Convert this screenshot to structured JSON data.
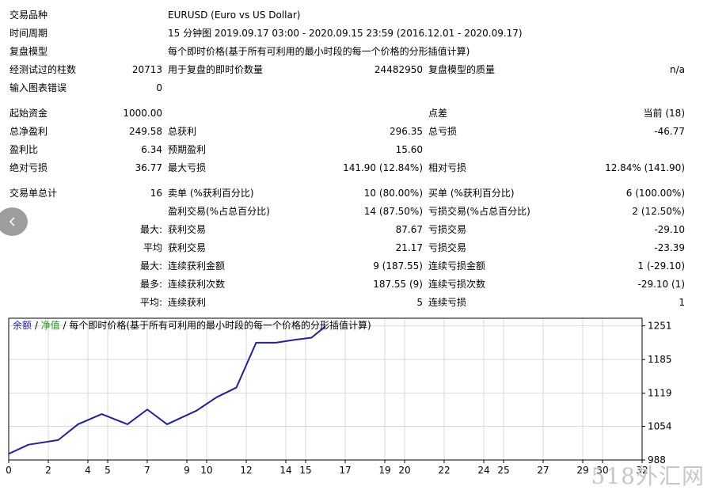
{
  "report": {
    "rows": [
      {
        "cells": [
          {
            "text": "交易品种",
            "x": 12,
            "a": "l"
          },
          {
            "text": "EURUSD (Euro vs US Dollar)",
            "x": 212,
            "a": "l"
          }
        ],
        "y": 11
      },
      {
        "cells": [
          {
            "text": "时间周期",
            "x": 12,
            "a": "l"
          },
          {
            "text": "15 分钟图 2019.09.17 03:00 - 2020.09.15 23:59 (2016.12.01 - 2020.09.17)",
            "x": 212,
            "a": "l"
          }
        ],
        "y": 34
      },
      {
        "cells": [
          {
            "text": "复盘模型",
            "x": 12,
            "a": "l"
          },
          {
            "text": "每个即时价格(基于所有可利用的最小时段的每一个价格的分形插值计算)",
            "x": 212,
            "a": "l"
          }
        ],
        "y": 57
      },
      {
        "cells": [
          {
            "text": "经测试过的柱数",
            "x": 12,
            "a": "l"
          },
          {
            "text": "20713",
            "x": 205,
            "a": "r"
          },
          {
            "text": "用于复盘的即时价数量",
            "x": 212,
            "a": "l"
          },
          {
            "text": "24482950",
            "x": 534,
            "a": "r"
          },
          {
            "text": "复盘模型的质量",
            "x": 541,
            "a": "l"
          },
          {
            "text": "n/a",
            "x": 865,
            "a": "r"
          }
        ],
        "y": 80
      },
      {
        "cells": [
          {
            "text": "输入图表错误",
            "x": 12,
            "a": "l"
          },
          {
            "text": "0",
            "x": 205,
            "a": "r"
          }
        ],
        "y": 103
      },
      {
        "cells": [
          {
            "text": "起始资金",
            "x": 12,
            "a": "l"
          },
          {
            "text": "1000.00",
            "x": 205,
            "a": "r"
          },
          {
            "text": "点差",
            "x": 541,
            "a": "l"
          },
          {
            "text": "当前 (18)",
            "x": 865,
            "a": "r"
          }
        ],
        "y": 135
      },
      {
        "cells": [
          {
            "text": "总净盈利",
            "x": 12,
            "a": "l"
          },
          {
            "text": "249.58",
            "x": 205,
            "a": "r"
          },
          {
            "text": "总获利",
            "x": 212,
            "a": "l"
          },
          {
            "text": "296.35",
            "x": 534,
            "a": "r"
          },
          {
            "text": "总亏损",
            "x": 541,
            "a": "l"
          },
          {
            "text": "-46.77",
            "x": 865,
            "a": "r"
          }
        ],
        "y": 158
      },
      {
        "cells": [
          {
            "text": "盈利比",
            "x": 12,
            "a": "l"
          },
          {
            "text": "6.34",
            "x": 205,
            "a": "r"
          },
          {
            "text": "预期盈利",
            "x": 212,
            "a": "l"
          },
          {
            "text": "15.60",
            "x": 534,
            "a": "r"
          }
        ],
        "y": 181
      },
      {
        "cells": [
          {
            "text": "绝对亏损",
            "x": 12,
            "a": "l"
          },
          {
            "text": "36.77",
            "x": 205,
            "a": "r"
          },
          {
            "text": "最大亏损",
            "x": 212,
            "a": "l"
          },
          {
            "text": "141.90 (12.84%)",
            "x": 534,
            "a": "r"
          },
          {
            "text": "相对亏损",
            "x": 541,
            "a": "l"
          },
          {
            "text": "12.84% (141.90)",
            "x": 865,
            "a": "r"
          }
        ],
        "y": 204
      },
      {
        "cells": [
          {
            "text": "交易单总计",
            "x": 12,
            "a": "l"
          },
          {
            "text": "16",
            "x": 205,
            "a": "r"
          },
          {
            "text": "卖单 (%获利百分比)",
            "x": 212,
            "a": "l"
          },
          {
            "text": "10 (80.00%)",
            "x": 534,
            "a": "r"
          },
          {
            "text": "买单 (%获利百分比)",
            "x": 541,
            "a": "l"
          },
          {
            "text": "6 (100.00%)",
            "x": 865,
            "a": "r"
          }
        ],
        "y": 236
      },
      {
        "cells": [
          {
            "text": "盈利交易(%占总百分比)",
            "x": 212,
            "a": "l"
          },
          {
            "text": "14 (87.50%)",
            "x": 534,
            "a": "r"
          },
          {
            "text": "亏损交易(%占总百分比)",
            "x": 541,
            "a": "l"
          },
          {
            "text": "2 (12.50%)",
            "x": 865,
            "a": "r"
          }
        ],
        "y": 259
      },
      {
        "cells": [
          {
            "text": "最大:",
            "x": 205,
            "a": "r"
          },
          {
            "text": "获利交易",
            "x": 212,
            "a": "l"
          },
          {
            "text": "87.67",
            "x": 534,
            "a": "r"
          },
          {
            "text": "亏损交易",
            "x": 541,
            "a": "l"
          },
          {
            "text": "-29.10",
            "x": 865,
            "a": "r"
          }
        ],
        "y": 282
      },
      {
        "cells": [
          {
            "text": "平均",
            "x": 205,
            "a": "r"
          },
          {
            "text": "获利交易",
            "x": 212,
            "a": "l"
          },
          {
            "text": "21.17",
            "x": 534,
            "a": "r"
          },
          {
            "text": "亏损交易",
            "x": 541,
            "a": "l"
          },
          {
            "text": "-23.39",
            "x": 865,
            "a": "r"
          }
        ],
        "y": 305
      },
      {
        "cells": [
          {
            "text": "最大:",
            "x": 205,
            "a": "r"
          },
          {
            "text": "连续获利金额",
            "x": 212,
            "a": "l"
          },
          {
            "text": "9 (187.55)",
            "x": 534,
            "a": "r"
          },
          {
            "text": "连续亏损金额",
            "x": 541,
            "a": "l"
          },
          {
            "text": "1 (-29.10)",
            "x": 865,
            "a": "r"
          }
        ],
        "y": 328
      },
      {
        "cells": [
          {
            "text": "最多:",
            "x": 205,
            "a": "r"
          },
          {
            "text": "连续获利次数",
            "x": 212,
            "a": "l"
          },
          {
            "text": "187.55 (9)",
            "x": 534,
            "a": "r"
          },
          {
            "text": "连续亏损次数",
            "x": 541,
            "a": "l"
          },
          {
            "text": "-29.10 (1)",
            "x": 865,
            "a": "r"
          }
        ],
        "y": 351
      },
      {
        "cells": [
          {
            "text": "平均:",
            "x": 205,
            "a": "r"
          },
          {
            "text": "连续获利",
            "x": 212,
            "a": "l"
          },
          {
            "text": "5",
            "x": 534,
            "a": "r"
          },
          {
            "text": "连续亏损",
            "x": 541,
            "a": "l"
          },
          {
            "text": "1",
            "x": 865,
            "a": "r"
          }
        ],
        "y": 374
      }
    ]
  },
  "nav": {
    "back_icon": "chevron-left-icon"
  },
  "chart_data": {
    "type": "line",
    "legend": {
      "balance": "余额",
      "sep1": " / ",
      "equity": "净值",
      "sep2": " / ",
      "model": "每个即时价格(基于所有可利用的最小时段的每一个价格的分形插值计算)"
    },
    "colors": {
      "balance": "#1f1fa8",
      "equity": "#1a9a1a",
      "axis": "#000000",
      "grid": "#d9d9d9"
    },
    "x_ticks": [
      0,
      2,
      4,
      5,
      7,
      9,
      10,
      12,
      14,
      15,
      17,
      19,
      20,
      22,
      24,
      25,
      27,
      29,
      30,
      32
    ],
    "x_tick_labels": [
      "0",
      "2",
      "4",
      "5",
      "7",
      "9",
      "10",
      "12",
      "14",
      "15",
      "17",
      "19",
      "20",
      "22",
      "24",
      "25",
      "27",
      "29",
      "30",
      "32"
    ],
    "xlim": [
      0,
      32
    ],
    "y_ticks": [
      988,
      1054,
      1119,
      1185,
      1251
    ],
    "y_tick_labels": [
      "988",
      "1054",
      "1119",
      "1185",
      "1251"
    ],
    "ylim": [
      988,
      1266
    ],
    "series": [
      {
        "key": "balance",
        "x": [
          0,
          1,
          2.5,
          3.5,
          4.7,
          6,
          7,
          8,
          9.5,
          10.5,
          11.5,
          12.5,
          13.5,
          14.5,
          15.3,
          16
        ],
        "values": [
          1000,
          1018,
          1027,
          1058,
          1078,
          1058,
          1087,
          1058,
          1085,
          1111,
          1130,
          1218,
          1218,
          1224,
          1228,
          1250
        ]
      }
    ]
  },
  "watermark": "518外汇网"
}
